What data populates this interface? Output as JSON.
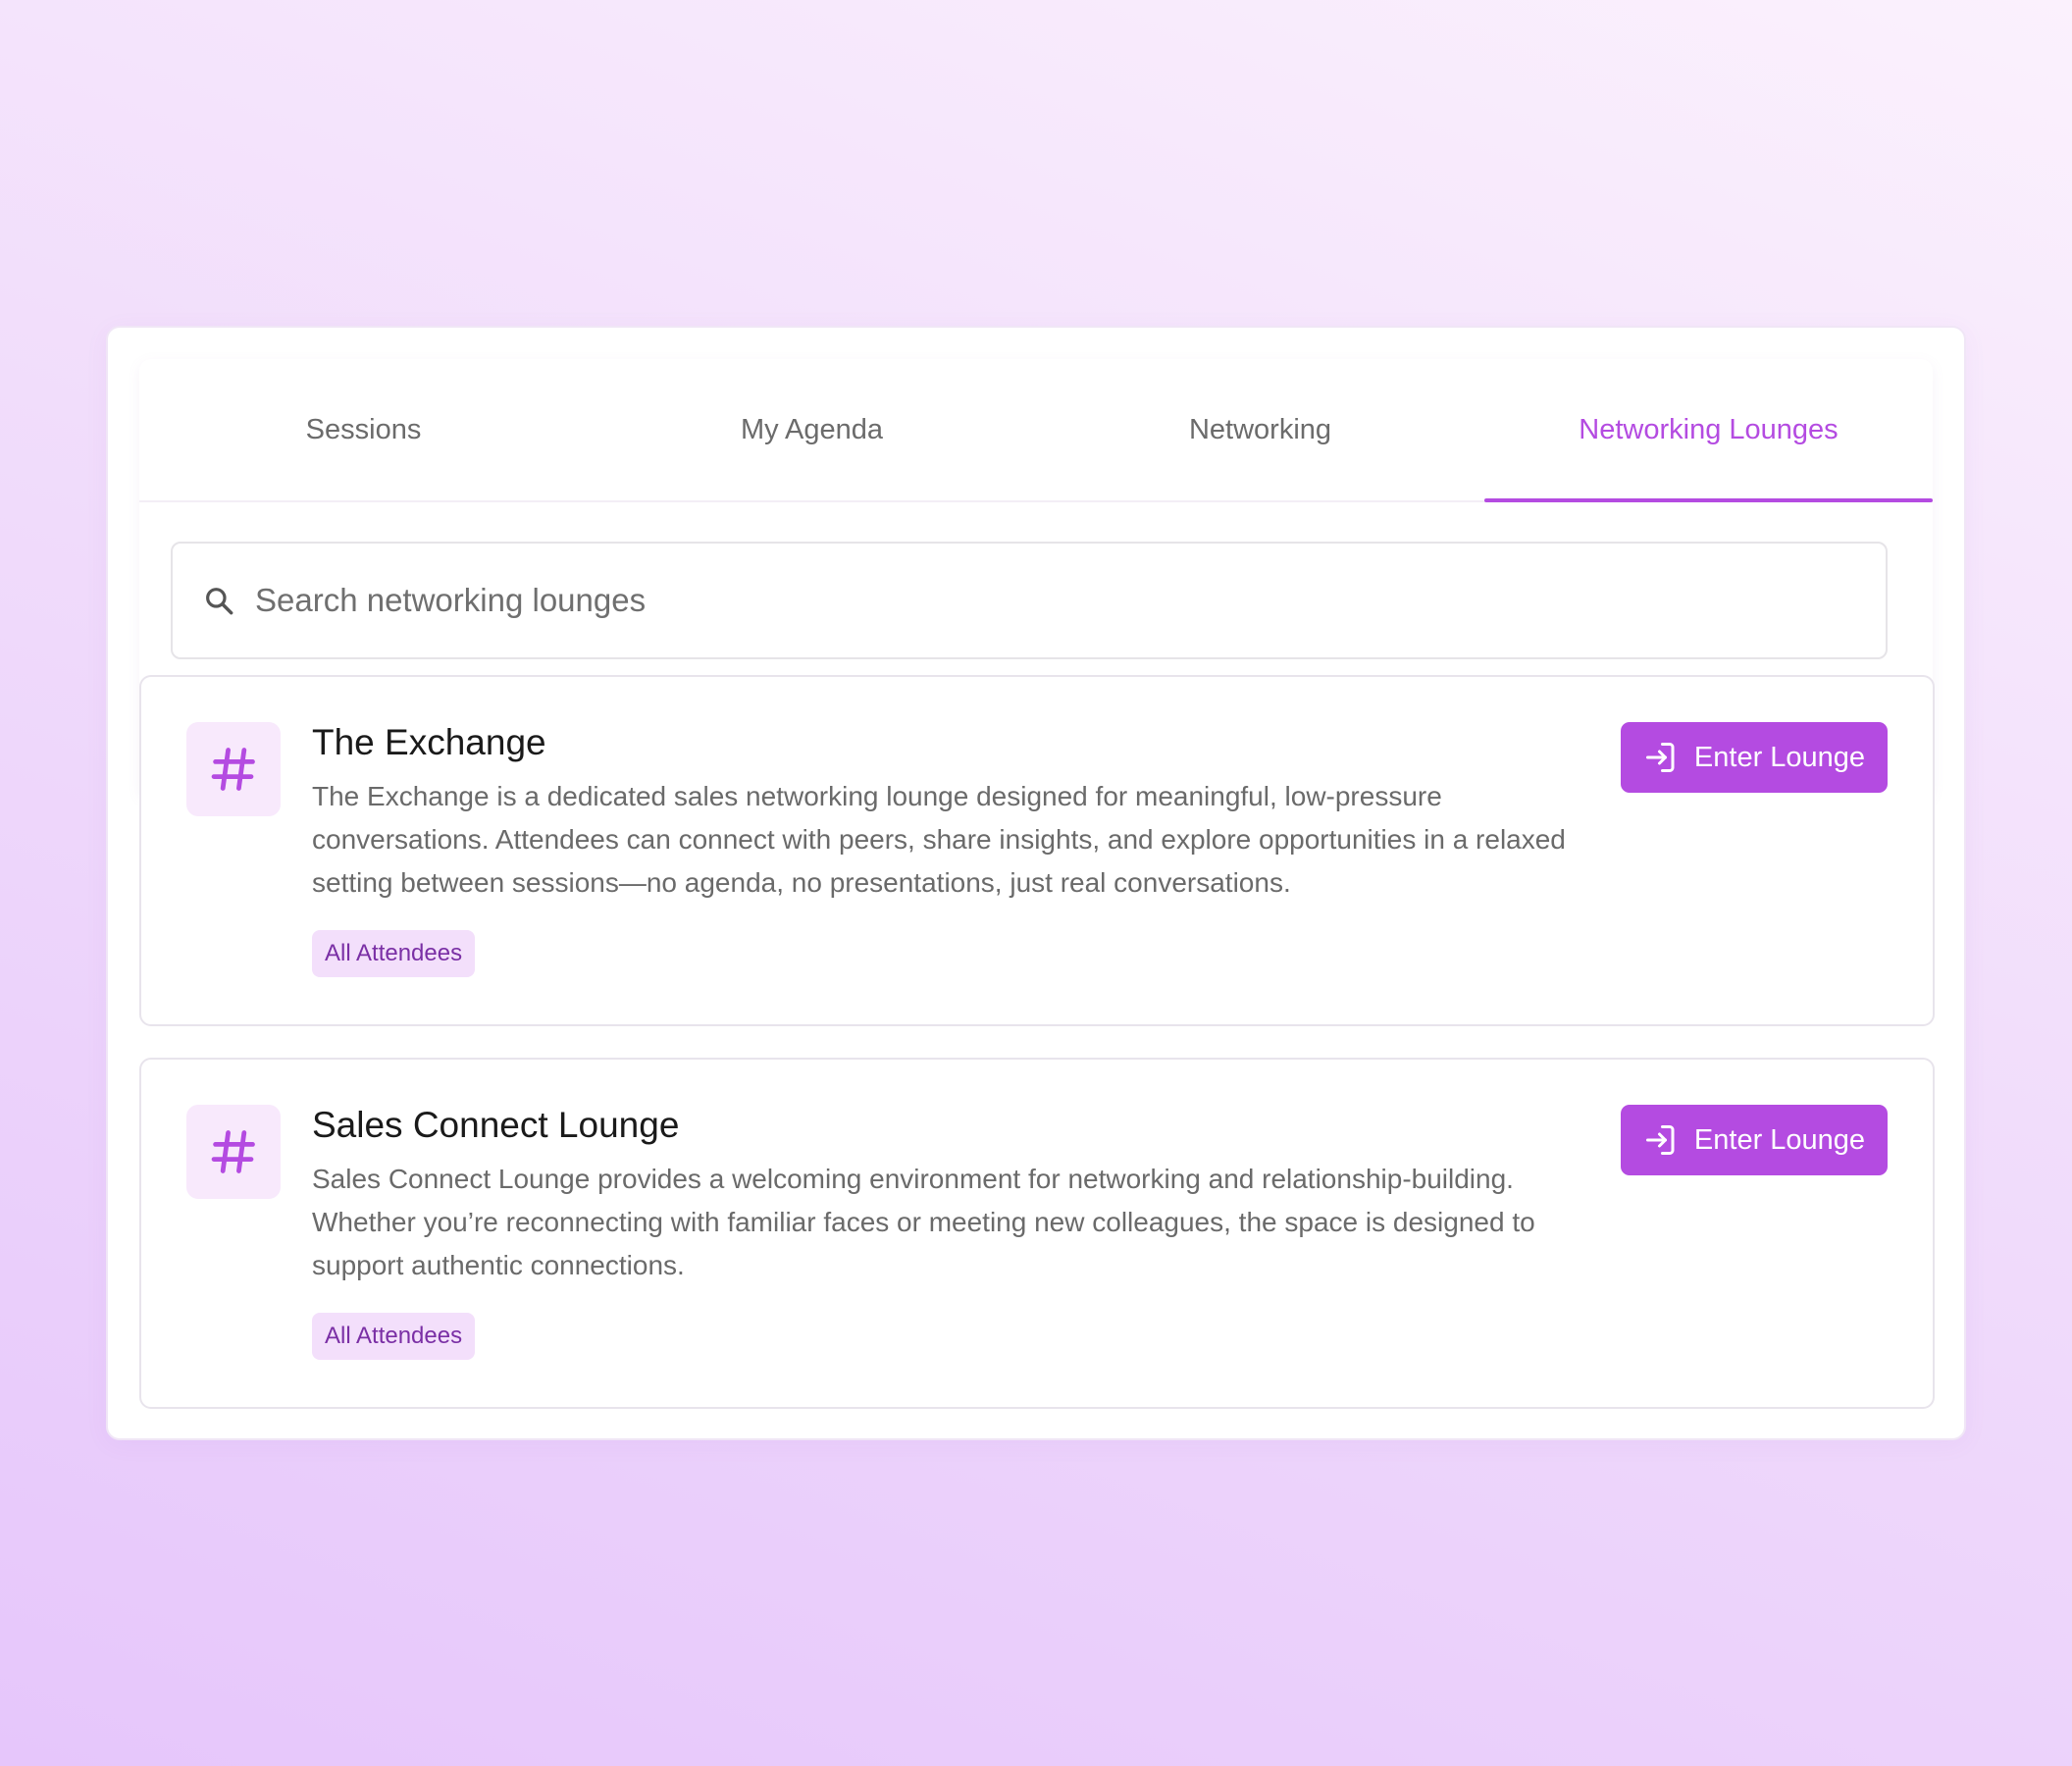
{
  "tabs": [
    {
      "label": "Sessions",
      "active": false
    },
    {
      "label": "My Agenda",
      "active": false
    },
    {
      "label": "Networking",
      "active": false
    },
    {
      "label": "Networking Lounges",
      "active": true
    }
  ],
  "search": {
    "placeholder": "Search networking lounges",
    "value": ""
  },
  "lounges": [
    {
      "icon": "hash-icon",
      "title": "The Exchange",
      "description": "The Exchange is a dedicated sales networking lounge designed for meaningful, low-pressure conversations. Attendees can connect with peers, share insights, and explore opportunities in a relaxed setting between sessions—no agenda, no presentations, just real conversations.",
      "tag": "All Attendees",
      "button_label": "Enter Lounge"
    },
    {
      "icon": "hash-icon",
      "title": "Sales Connect Lounge",
      "description": "Sales Connect Lounge provides a welcoming environment for networking and relationship-building. Whether you’re reconnecting with familiar faces or meeting new colleagues, the space is designed to support authentic connections.",
      "tag": "All Attendees",
      "button_label": "Enter Lounge"
    }
  ],
  "colors": {
    "accent": "#b44be1",
    "tag_bg": "#f3dffb",
    "tag_text": "#7a2fa5",
    "icon_bg": "#f8e9fc"
  }
}
